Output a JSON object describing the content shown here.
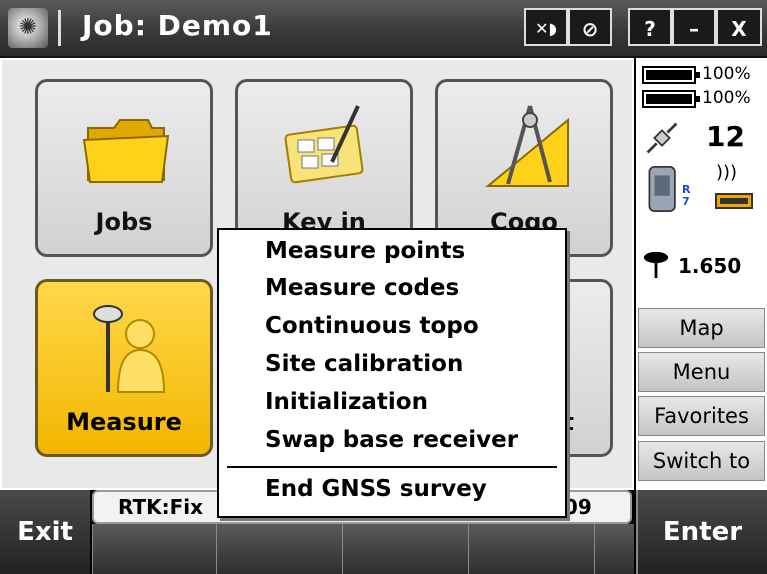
{
  "titlebar": {
    "title": "Job: Demo1",
    "btn_help": "?",
    "btn_minimize": "–",
    "btn_close": "X"
  },
  "tiles": [
    {
      "label": "Jobs"
    },
    {
      "label": "Key in"
    },
    {
      "label": "Cogo"
    },
    {
      "label": "Measure"
    },
    {
      "label": "nt"
    }
  ],
  "menu": {
    "items": [
      "Measure points",
      "Measure codes",
      "Continuous topo",
      "Site calibration",
      "Initialization",
      "Swap base receiver"
    ],
    "footer_item": "End GNSS survey"
  },
  "sidebar": {
    "battery1": "100%",
    "battery2": "100%",
    "satellites": "12",
    "rover_badge": "R7",
    "antenna_height": "1.650",
    "buttons": [
      "Map",
      "Menu",
      "Favorites",
      "Switch to"
    ]
  },
  "status": {
    "left_text": "RTK:Fix",
    "right_text": "009"
  },
  "softkeys": {
    "exit": "Exit",
    "enter": "Enter"
  },
  "colors": {
    "accent_yellow": "#f2b600",
    "folder_yellow": "#f5c400"
  }
}
